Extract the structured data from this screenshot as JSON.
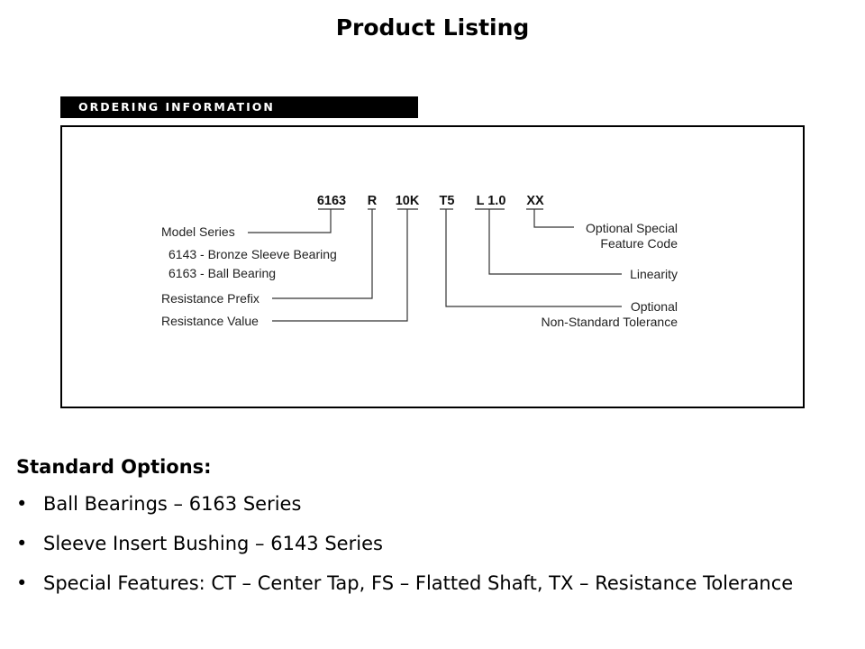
{
  "page": {
    "title": "Product Listing"
  },
  "ordering_information": {
    "banner": "ORDERING INFORMATION",
    "codes": [
      "6163",
      "R",
      "10K",
      "T5",
      "L 1.0",
      "XX"
    ],
    "left_labels": {
      "model_series": "Model Series",
      "model_option_1": "6143 - Bronze Sleeve Bearing",
      "model_option_2": "6163 - Ball Bearing",
      "resistance_prefix": "Resistance Prefix",
      "resistance_value": "Resistance Value"
    },
    "right_labels": {
      "special_feature_line1": "Optional Special",
      "special_feature_line2": "Feature Code",
      "linearity": "Linearity",
      "tolerance_line1": "Optional",
      "tolerance_line2": "Non-Standard Tolerance"
    }
  },
  "standard_options": {
    "heading": "Standard Options:",
    "bullet_glyph": "•",
    "items": [
      "Ball Bearings – 6163 Series",
      "Sleeve Insert Bushing – 6143 Series",
      "Special Features:  CT – Center Tap, FS – Flatted Shaft, TX – Resistance Tolerance"
    ]
  }
}
